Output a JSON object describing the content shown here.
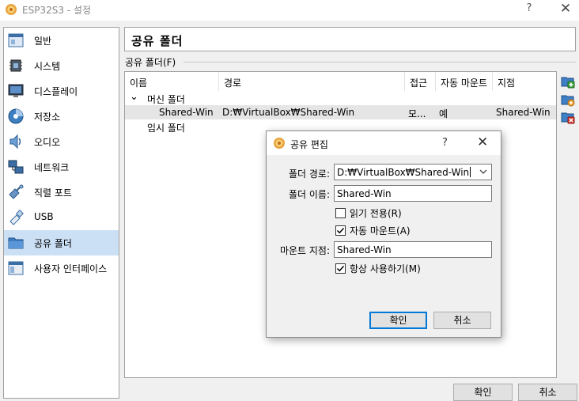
{
  "window": {
    "title": "ESP32S3 - 설정",
    "help": "?",
    "close": "✕",
    "icon": "virtualbox-gear-icon"
  },
  "sidebar": {
    "items": [
      {
        "label": "일반",
        "icon": "general-icon"
      },
      {
        "label": "시스템",
        "icon": "system-chip-icon"
      },
      {
        "label": "디스플레이",
        "icon": "display-monitor-icon"
      },
      {
        "label": "저장소",
        "icon": "storage-disk-icon"
      },
      {
        "label": "오디오",
        "icon": "audio-speaker-icon"
      },
      {
        "label": "네트워크",
        "icon": "network-icon"
      },
      {
        "label": "직렬 포트",
        "icon": "serial-port-icon"
      },
      {
        "label": "USB",
        "icon": "usb-icon"
      },
      {
        "label": "공유 폴더",
        "icon": "shared-folder-icon"
      },
      {
        "label": "사용자 인터페이스",
        "icon": "user-interface-icon"
      }
    ],
    "selected": "공유 폴더"
  },
  "page": {
    "title": "공유 폴더"
  },
  "shared_folders": {
    "group_label": "공유 폴더(F)",
    "columns": [
      "이름",
      "경로",
      "접근",
      "자동 마운트",
      "지점"
    ],
    "groups": [
      {
        "name": "머신 폴더",
        "expander": "⌄"
      },
      {
        "name": "임시 폴더"
      }
    ],
    "rows": [
      {
        "name": "Shared-Win",
        "path": "D:₩VirtualBox₩Shared-Win",
        "access": "모...",
        "auto_mount": "예",
        "mount_point": "Shared-Win"
      }
    ],
    "toolbar": [
      "add-folder-icon",
      "edit-folder-icon",
      "remove-folder-icon"
    ]
  },
  "buttons": {
    "ok": "확인",
    "cancel": "취소"
  },
  "dialog": {
    "title": "공유 편집",
    "help": "?",
    "close": "✕",
    "folder_path_label": "폴더 경로:",
    "folder_path_value": "D:₩VirtualBox₩Shared-Win",
    "folder_name_label": "폴더 이름:",
    "folder_name_value": "Shared-Win",
    "read_only_label": "읽기 전용(R)",
    "read_only_checked": false,
    "auto_mount_label": "자동 마운트(A)",
    "auto_mount_checked": true,
    "mount_point_label": "마운트 지점:",
    "mount_point_value": "Shared-Win",
    "permanent_label": "항상 사용하기(M)",
    "permanent_checked": true,
    "ok": "확인",
    "cancel": "취소"
  },
  "colors": {
    "selection": "#cce0f5",
    "row_selection": "#e5e5e5",
    "accent": "#0078d7"
  }
}
